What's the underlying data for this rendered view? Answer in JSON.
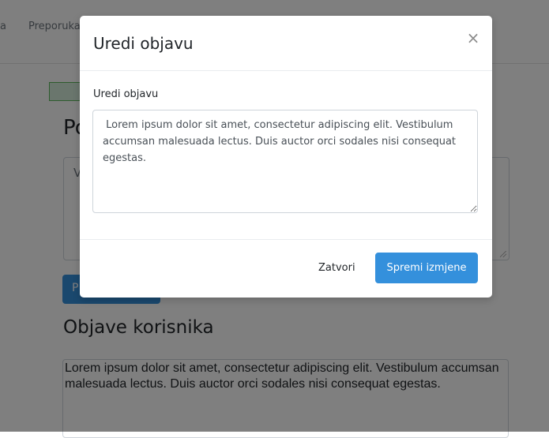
{
  "navbar": {
    "links": [
      "a",
      "Preporuka"
    ]
  },
  "background": {
    "heading": "Po",
    "textarea_placeholder": "V",
    "button_label": "P",
    "section_title": "Objave korisnika",
    "post_text": "Lorem ipsum dolor sit amet, consectetur adipiscing elit. Vestibulum accumsan malesuada lectus. Duis auctor orci sodales nisi consequat egestas."
  },
  "modal": {
    "title": "Uredi objavu",
    "close_symbol": "×",
    "field_label": "Uredi objavu",
    "textarea_value": " Lorem ipsum dolor sit amet, consectetur adipiscing elit. Vestibulum accumsan malesuada lectus. Duis auctor orci sodales nisi consequat egestas.",
    "close_label": "Zatvori",
    "save_label": "Spremi izmjene"
  },
  "colors": {
    "primary": "#3490dc",
    "backdrop": "#000000",
    "alert_border": "#5cb85c"
  }
}
